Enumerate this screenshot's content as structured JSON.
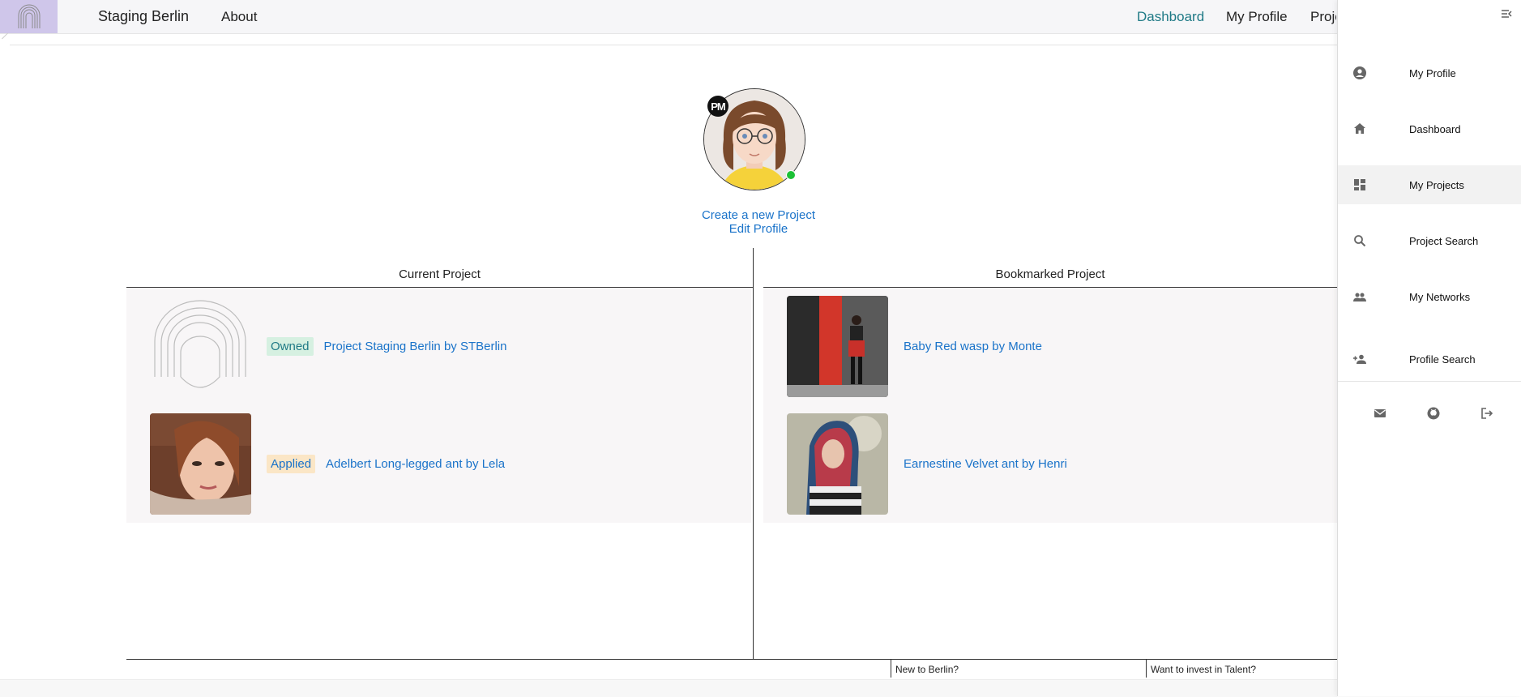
{
  "header": {
    "brand": "Staging Berlin",
    "about": "About",
    "nav": {
      "dashboard": "Dashboard",
      "my_profile": "My Profile",
      "projects": "Projects"
    },
    "active_color": "#1f7a86"
  },
  "profile": {
    "initials": "PM",
    "online": true,
    "create_project": "Create a new Project",
    "edit_profile": "Edit Profile"
  },
  "current": {
    "title": "Current Project",
    "items": [
      {
        "badge": "Owned",
        "label": "Project Staging Berlin by STBerlin"
      },
      {
        "badge": "Applied",
        "label": "Adelbert Long-legged ant by Lela"
      }
    ]
  },
  "bookmarked": {
    "title": "Bookmarked Project",
    "items": [
      {
        "label": "Baby Red wasp by Monte"
      },
      {
        "label": "Earnestine Velvet ant by Henri"
      }
    ]
  },
  "footer": {
    "new_to_berlin": "New to Berlin?",
    "invest": "Want to invest in Talent?"
  },
  "drawer": {
    "items": [
      {
        "label": "My Profile",
        "icon": "account-circle-icon"
      },
      {
        "label": "Dashboard",
        "icon": "home-icon"
      },
      {
        "label": "My Projects",
        "icon": "dashboard-grid-icon",
        "active": true
      },
      {
        "label": "Project Search",
        "icon": "search-icon"
      },
      {
        "label": "My Networks",
        "icon": "people-icon"
      },
      {
        "label": "Profile Search",
        "icon": "person-add-icon"
      }
    ],
    "footer_icons": [
      "mail-icon",
      "github-icon",
      "logout-icon"
    ]
  }
}
